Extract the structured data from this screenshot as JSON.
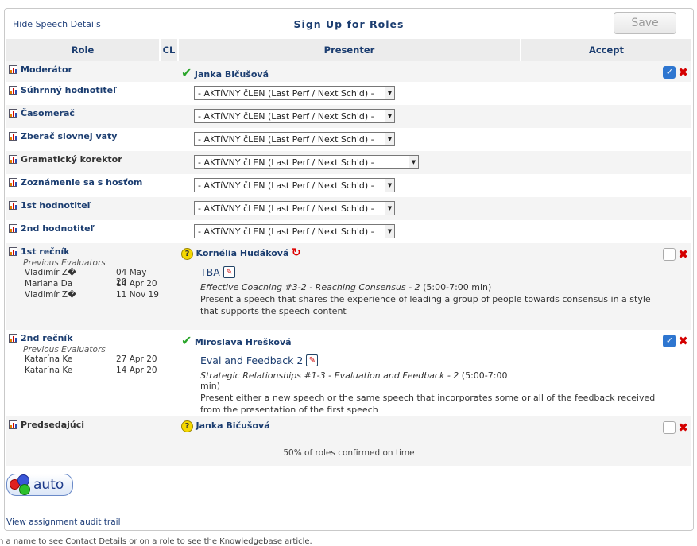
{
  "header": {
    "hide_link": "Hide Speech Details",
    "title": "Sign Up for Roles",
    "save_label": "Save"
  },
  "columns": {
    "role": "Role",
    "cl": "CL",
    "presenter": "Presenter",
    "accept": "Accept"
  },
  "roles": [
    {
      "name": "Moderátor",
      "status": "confirmed",
      "presenter": "Janka Bičušová",
      "accepted": true
    },
    {
      "name": "Súhrnný hodnotiteľ",
      "select": "- AKTíVNY čLEN (Last Perf / Next Sch'd) -"
    },
    {
      "name": "Časomerač",
      "select": "- AKTíVNY čLEN (Last Perf / Next Sch'd) -"
    },
    {
      "name": "Zberač slovnej vaty",
      "select": "- AKTíVNY čLEN (Last Perf / Next Sch'd) -"
    },
    {
      "name": "Gramatický korektor",
      "select": "- AKTíVNY čLEN (Last Perf / Next Sch'd) -"
    },
    {
      "name": "Zoznámenie sa s hosťom",
      "select": "- AKTíVNY čLEN (Last Perf / Next Sch'd) -"
    },
    {
      "name": "1st hodnotiteľ",
      "select": "- AKTíVNY čLEN (Last Perf / Next Sch'd) -"
    },
    {
      "name": "2nd hodnotiteľ",
      "select": "- AKTíVNY čLEN (Last Perf / Next Sch'd) -"
    },
    {
      "name": "1st rečník",
      "status": "pending",
      "presenter": "Kornélia Hudáková",
      "accepted": false,
      "prev_title": "Previous Evaluators",
      "prev": [
        {
          "name": "Vladimír Z�",
          "date": "04 May 20"
        },
        {
          "name": "Mariana Da",
          "date": "14 Apr 20"
        },
        {
          "name": "Vladimír Z�",
          "date": "11 Nov 19"
        }
      ],
      "speech_title": "TBA",
      "project": "Effective Coaching #3-2 - Reaching Consensus - 2",
      "time": "(5:00-7:00 min)",
      "description": "Present a speech that shares the experience of leading a group of people towards consensus in a style that supports the speech content"
    },
    {
      "name": "2nd rečník",
      "status": "confirmed",
      "presenter": "Miroslava Hrešková",
      "accepted": true,
      "prev_title": "Previous Evaluators",
      "prev": [
        {
          "name": "Katarína Ke",
          "date": "27 Apr 20"
        },
        {
          "name": "Katarína Ke",
          "date": "14 Apr 20"
        }
      ],
      "speech_title": "Eval and Feedback 2",
      "project": "Strategic Relationships #1-3 - Evaluation and Feedback - 2",
      "time": "(5:00-7:00 min)",
      "description": "Present either a new speech or the same speech that incorporates some or all of the feedback received from the presentation of the first speech"
    },
    {
      "name": "Predsedajúci",
      "status": "pending",
      "presenter": "Janka Bičušová",
      "accepted": false
    }
  ],
  "summary": "50% of roles confirmed on time",
  "auto_label": "auto",
  "audit_link": "View assignment audit trail",
  "bottom_note": "n a name to see Contact Details or on a role to see the Knowledgebase article."
}
